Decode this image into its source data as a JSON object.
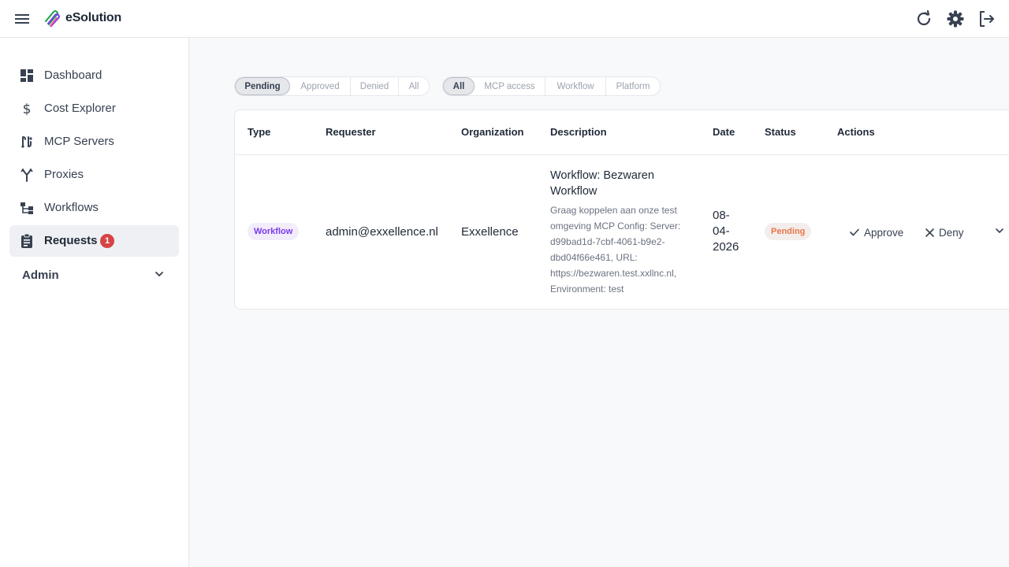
{
  "app": {
    "brand": "eSolution"
  },
  "topbar": {
    "icons": [
      "menu-icon",
      "refresh-icon",
      "gear-icon",
      "logout-icon"
    ]
  },
  "sidebar": {
    "items": [
      {
        "label": "Dashboard",
        "icon": "dashboard-icon"
      },
      {
        "label": "Cost Explorer",
        "icon": "dollar-icon"
      },
      {
        "label": "MCP Servers",
        "icon": "mcp-icon"
      },
      {
        "label": "Proxies",
        "icon": "fork-icon"
      },
      {
        "label": "Workflows",
        "icon": "workflow-icon"
      },
      {
        "label": "Requests",
        "icon": "clipboard-icon",
        "badge": "1",
        "active": true
      }
    ],
    "admin_label": "Admin"
  },
  "filters": {
    "status": [
      "Pending",
      "Approved",
      "Denied",
      "All"
    ],
    "status_selected": "Pending",
    "type": [
      "All",
      "MCP access",
      "Workflow",
      "Platform"
    ],
    "type_selected": "All"
  },
  "table": {
    "headers": [
      "Type",
      "Requester",
      "Organization",
      "Description",
      "Date",
      "Status",
      "Actions"
    ],
    "rows": [
      {
        "type": "Workflow",
        "requester": "admin@exxellence.nl",
        "organization": "Exxellence",
        "description_title": "Workflow: Bezwaren Workflow",
        "description_body": "Graag koppelen aan onze test omgeving MCP Config: Server: d99bad1d-7cbf-4061-b9e2-dbd04f66e461, URL: https://bezwaren.test.xxllnc.nl, Environment: test",
        "date": "08-04-2026",
        "status": "Pending",
        "approve_label": "Approve",
        "deny_label": "Deny"
      }
    ]
  },
  "colors": {
    "accent_badge": "#d64545",
    "type_badge_text": "#7c3aed",
    "status_pending_text": "#e8764a"
  }
}
